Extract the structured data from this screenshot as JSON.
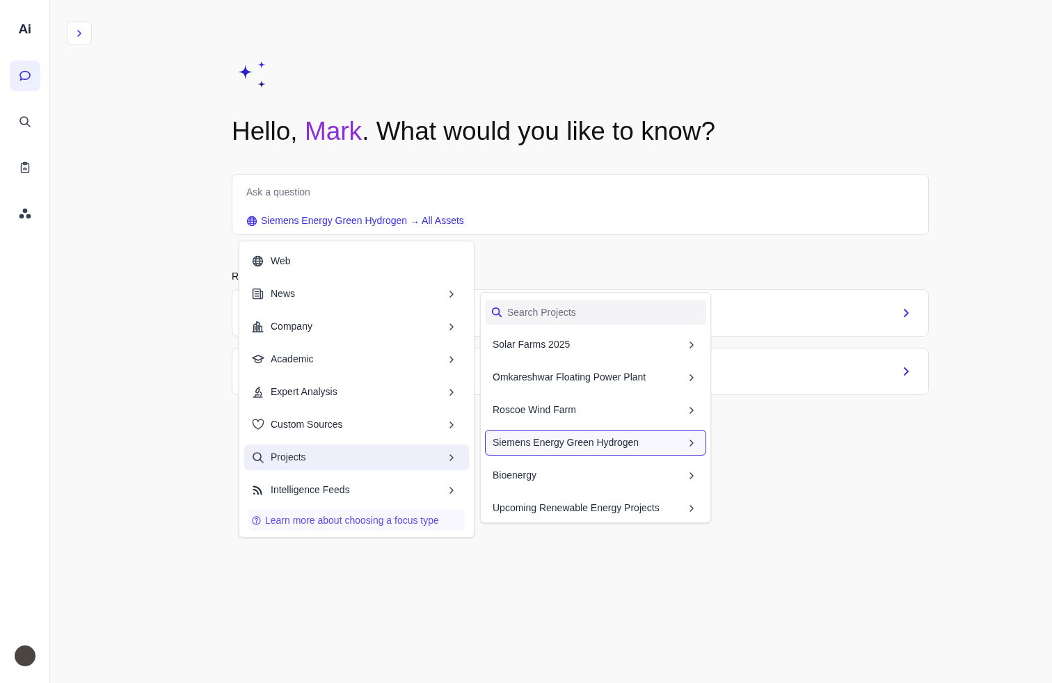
{
  "sidebar": {
    "logo": "Ai",
    "items": [
      {
        "selected": true
      },
      {
        "selected": false
      },
      {
        "selected": false
      },
      {
        "selected": false
      }
    ]
  },
  "greeting": {
    "prefix": "Hello, ",
    "name": "Mark",
    "suffix": ". What would you like to know?"
  },
  "ask": {
    "placeholder": "Ask a question",
    "focus": "Siemens Energy Green Hydrogen → All Assets"
  },
  "recent": {
    "heading": "R",
    "cards": [
      {
        "kind": "link"
      },
      {
        "kind": "link"
      }
    ]
  },
  "focus_menu": {
    "items": [
      {
        "label": "Web",
        "submenu": false,
        "selected": false
      },
      {
        "label": "News",
        "submenu": true,
        "selected": false
      },
      {
        "label": "Company",
        "submenu": true,
        "selected": false
      },
      {
        "label": "Academic",
        "submenu": true,
        "selected": false
      },
      {
        "label": "Expert Analysis",
        "submenu": true,
        "selected": false
      },
      {
        "label": "Custom Sources",
        "submenu": true,
        "selected": false
      },
      {
        "label": "Projects",
        "submenu": true,
        "selected": true
      },
      {
        "label": "Intelligence Feeds",
        "submenu": true,
        "selected": false
      }
    ],
    "help_link": "Learn more about choosing a focus type"
  },
  "projects_menu": {
    "search_placeholder": "Search Projects",
    "items": [
      {
        "label": "Solar Farms 2025",
        "selected": false
      },
      {
        "label": "Omkareshwar Floating Power Plant",
        "selected": false
      },
      {
        "label": "Roscoe Wind Farm",
        "selected": false
      },
      {
        "label": "Siemens Energy Green Hydrogen",
        "selected": true
      },
      {
        "label": "Bioenergy",
        "selected": false
      },
      {
        "label": "Upcoming Renewable Energy Projects",
        "selected": false
      }
    ]
  }
}
